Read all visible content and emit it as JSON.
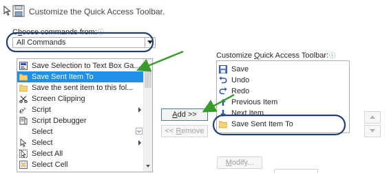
{
  "header": {
    "title": "Customize the Quick Access Toolbar."
  },
  "choose": {
    "label_pre": "C",
    "label_u": "h",
    "label_post": "oose commands from:",
    "info_icon": "ⓘ",
    "selected": "All Commands"
  },
  "commands": {
    "items": [
      {
        "label": "Save Selection to Text Box Ga...",
        "icon": "textbox-gallery-icon",
        "selected": false
      },
      {
        "label": "Save Sent Item To",
        "icon": "folder-icon",
        "selected": true
      },
      {
        "label": "Save the sent item to this fol...",
        "icon": "folder-icon",
        "selected": false
      },
      {
        "label": "Screen Clipping",
        "icon": "screen-clipping-icon",
        "selected": false
      },
      {
        "label": "Script",
        "icon": "script-icon",
        "selected": false,
        "submenu": true
      },
      {
        "label": "Script Debugger",
        "icon": "script-debugger-icon",
        "selected": false
      },
      {
        "label": "Select",
        "icon": "",
        "selected": false,
        "expand": true
      },
      {
        "label": "Select",
        "icon": "select-cursor-icon",
        "selected": false,
        "submenu": true
      },
      {
        "label": "Select All",
        "icon": "select-all-icon",
        "selected": false
      },
      {
        "label": "Select Cell",
        "icon": "select-cell-icon",
        "selected": false
      }
    ]
  },
  "qat": {
    "label_pre": "Customize ",
    "label_u": "Q",
    "label_post": "uick Access Toolbar:",
    "info_icon": "ⓘ",
    "items": [
      {
        "label": "Save",
        "icon": "save-icon"
      },
      {
        "label": "Undo",
        "icon": "undo-icon"
      },
      {
        "label": "Redo",
        "icon": "redo-icon"
      },
      {
        "label": "Previous Item",
        "icon": "up-arrow-icon"
      },
      {
        "label": "Next Item",
        "icon": "down-arrow-icon"
      },
      {
        "label": "Save Sent Item To",
        "icon": "folder-icon"
      }
    ]
  },
  "buttons": {
    "add_u": "A",
    "add_rest": "dd >>",
    "remove_pre": "<< ",
    "remove_u": "R",
    "remove_rest": "emove",
    "modify_u": "M",
    "modify_rest": "odify..."
  },
  "colors": {
    "selection": "#1e90e8",
    "annotation_circle": "#1f3f6e",
    "annotation_arrow": "#3a9b2d"
  }
}
